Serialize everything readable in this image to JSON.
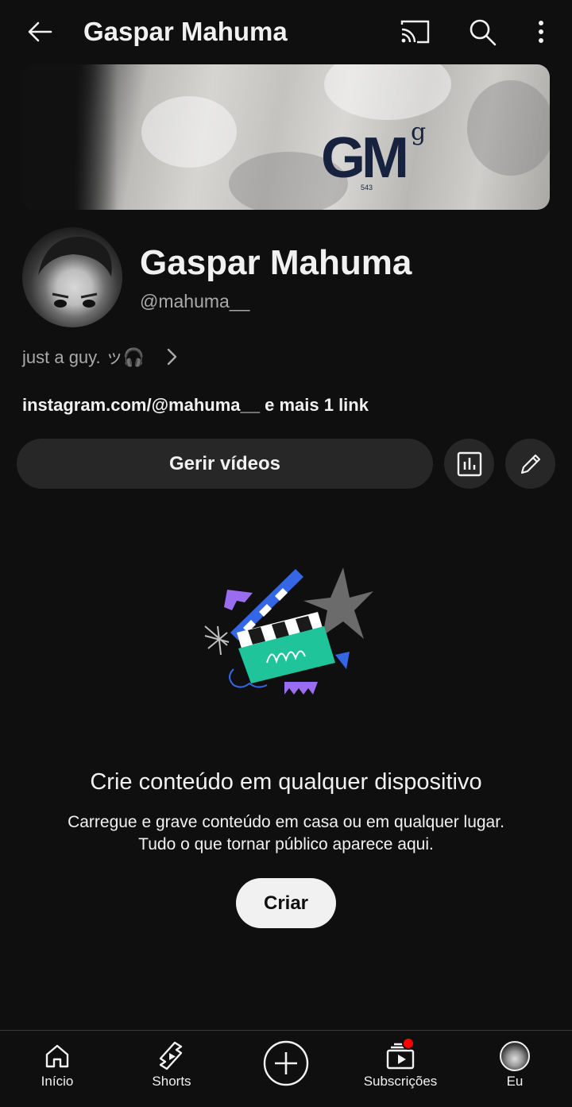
{
  "header": {
    "title": "Gaspar Mahuma"
  },
  "banner": {
    "logo_text": "GM",
    "logo_superscript": "g",
    "logo_number": "543"
  },
  "channel": {
    "name": "Gaspar Mahuma",
    "handle": "@mahuma__",
    "description": "just a guy. ッ🎧",
    "link_text": "instagram.com/@mahuma__",
    "more_links": " e mais 1 link"
  },
  "actions": {
    "manage_videos": "Gerir vídeos"
  },
  "empty_state": {
    "title": "Crie conteúdo em qualquer dispositivo",
    "subtitle_line1": "Carregue e grave conteúdo em casa ou em qualquer lugar.",
    "subtitle_line2": "Tudo o que tornar público aparece aqui.",
    "create_button": "Criar"
  },
  "bottom_nav": {
    "home": "Início",
    "shorts": "Shorts",
    "subscriptions": "Subscrições",
    "me": "Eu"
  },
  "colors": {
    "background": "#0f0f0f",
    "surface": "#272727",
    "text_secondary": "#aaaaaa",
    "notification_dot": "#ff0000",
    "illustration_teal": "#1fc49b",
    "illustration_blue": "#3466e6",
    "illustration_purple": "#9a6cf0"
  }
}
